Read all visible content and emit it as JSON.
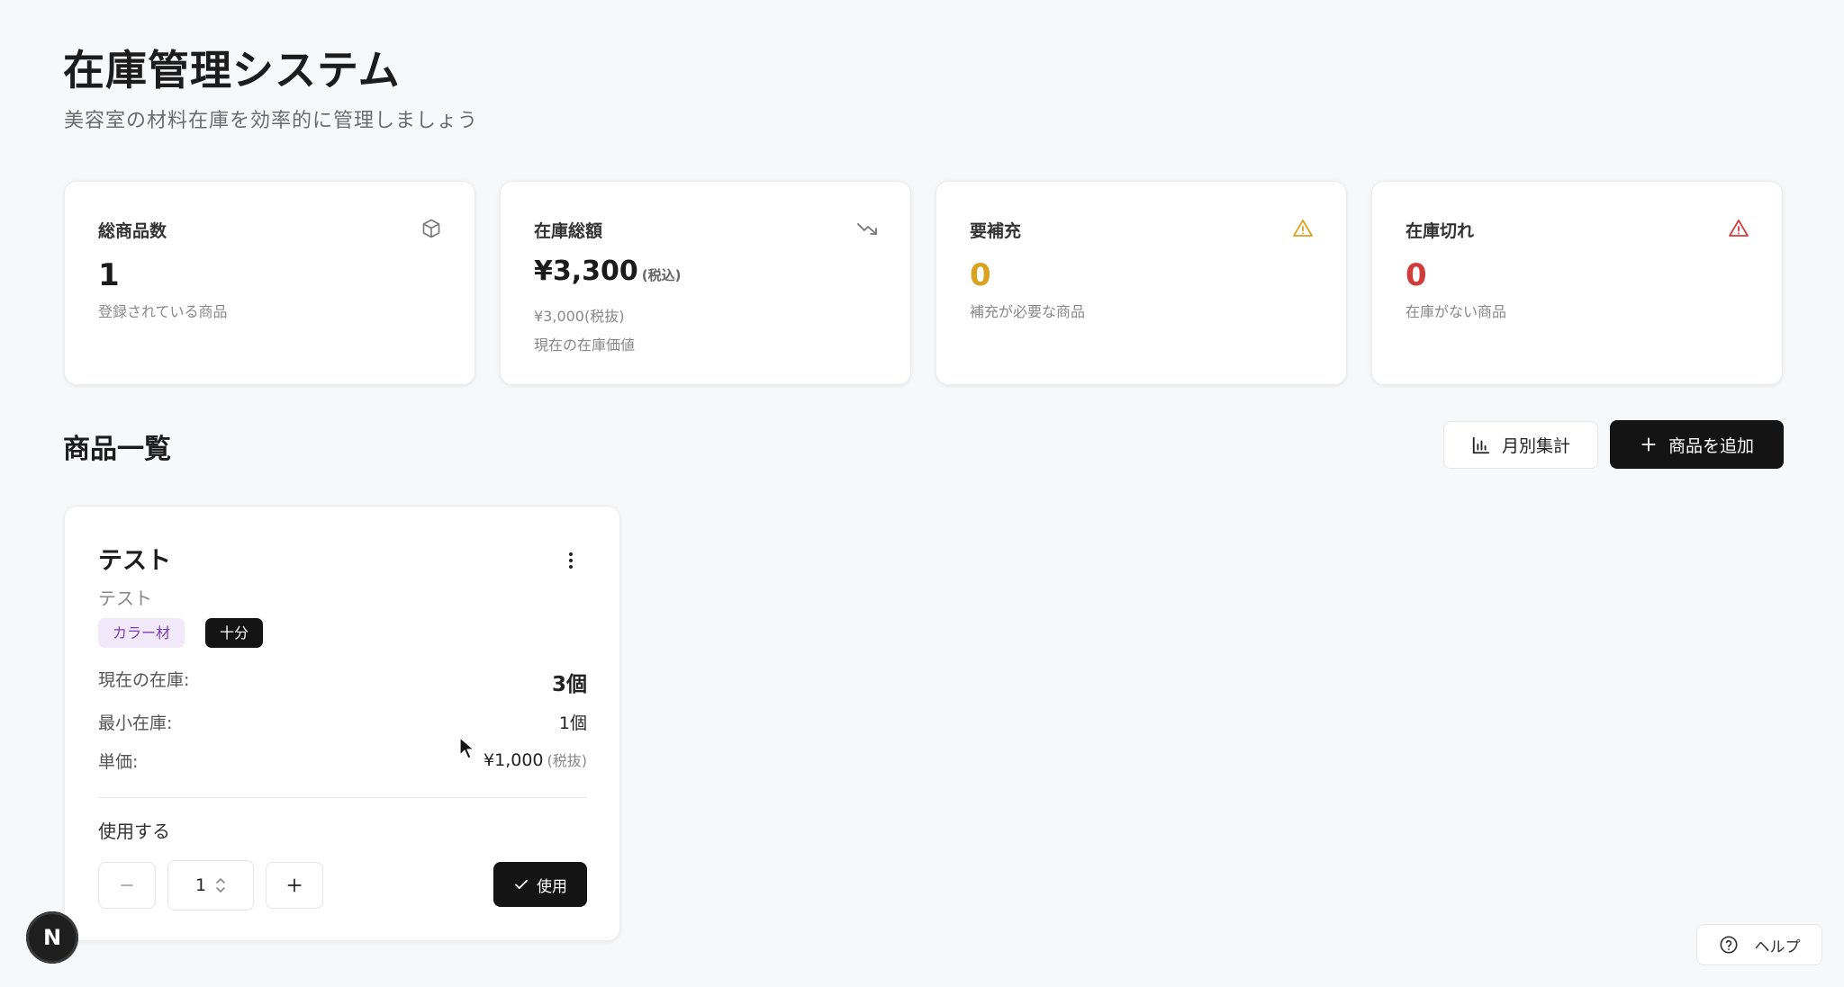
{
  "header": {
    "title": "在庫管理システム",
    "subtitle": "美容室の材料在庫を効率的に管理しましょう"
  },
  "stats": [
    {
      "label": "総商品数",
      "value": "1",
      "sub": "登録されている商品",
      "icon": "cube-icon"
    },
    {
      "label": "在庫総額",
      "value": "¥3,300",
      "value_tax": "(税込)",
      "sub": "¥3,000(税抜)",
      "sub2": "現在の在庫価値",
      "icon": "trending-down-icon"
    },
    {
      "label": "要補充",
      "value": "0",
      "sub": "補充が必要な商品",
      "icon": "warning-icon",
      "color": "#d9a320"
    },
    {
      "label": "在庫切れ",
      "value": "0",
      "sub": "在庫がない商品",
      "icon": "alert-triangle-icon",
      "color": "#d23b3b"
    }
  ],
  "products_section": {
    "title": "商品一覧",
    "monthly_label": "月別集計",
    "add_label": "商品を追加"
  },
  "product": {
    "name": "テスト",
    "description": "テスト",
    "category": "カラー材",
    "status": "十分",
    "current_stock_label": "現在の在庫:",
    "current_stock_value": "3個",
    "min_stock_label": "最小在庫:",
    "min_stock_value": "1個",
    "unit_price_label": "単価:",
    "unit_price_value": "¥1,000",
    "unit_price_tax": "(税抜)",
    "use_label": "使用する",
    "quantity": "1",
    "use_button": "使用"
  },
  "badge": {
    "letter": "N"
  },
  "help": {
    "label": "ヘルプ"
  },
  "colors": {
    "accent_dark": "#141414",
    "warning": "#d9a320",
    "danger": "#d23b3b",
    "category_bg": "#f1e9fa",
    "category_text": "#7b3fb0"
  }
}
